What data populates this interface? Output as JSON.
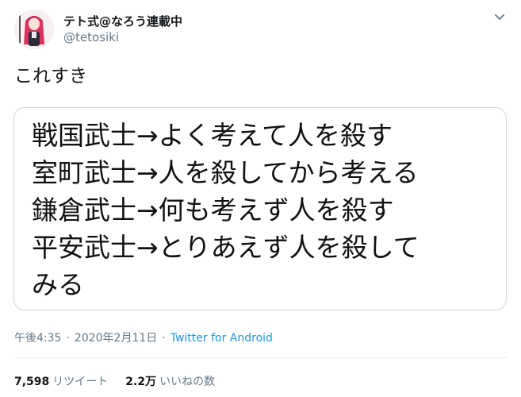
{
  "author": {
    "display_name": "テト式@なろう連載中",
    "handle": "@tetosiki",
    "avatar_icon": "avatar-image"
  },
  "tweet": {
    "text": "これすき",
    "image_lines": [
      "戦国武士→よく考えて人を殺す",
      "室町武士→人を殺してから考える",
      "鎌倉武士→何も考えず人を殺す",
      "平安武士→とりあえず人を殺して",
      "みる"
    ]
  },
  "meta": {
    "time": "午後4:35",
    "date": "2020年2月11日",
    "separator": "·",
    "source": "Twitter for Android"
  },
  "stats": {
    "retweets_count": "7,598",
    "retweets_label": "リツイート",
    "likes_count": "2.2万",
    "likes_label": "いいねの数"
  },
  "colors": {
    "link": "#1b95e0",
    "secondary_text": "#657786",
    "border": "#ccd6dd"
  },
  "icons": {
    "menu": "chevron-down-icon"
  }
}
